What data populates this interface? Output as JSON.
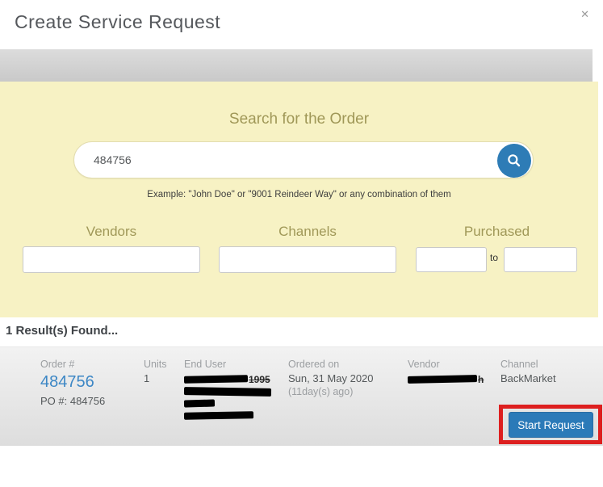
{
  "modal": {
    "title": "Create Service Request",
    "close_glyph": "✕"
  },
  "search": {
    "heading": "Search for the Order",
    "query": "484756",
    "hint": "Example: \"John Doe\" or \"9001 Reindeer Way\" or any combination of them",
    "filters": {
      "vendors_label": "Vendors",
      "channels_label": "Channels",
      "purchased_label": "Purchased",
      "to_label": "to"
    }
  },
  "results": {
    "count_text": "1 Result(s) Found...",
    "row": {
      "order_label": "Order #",
      "order_number": "484756",
      "po_text": "PO #: 484756",
      "units_label": "Units",
      "units_value": "1",
      "end_user_label": "End User",
      "end_user_redactions": [
        {
          "style": "width:79px",
          "peek": "1995"
        },
        {
          "style": "width:108px",
          "peek": ""
        },
        {
          "style": "width:38px",
          "peek": ""
        },
        {
          "style": "width:86px",
          "peek": ""
        }
      ],
      "ordered_label": "Ordered on",
      "ordered_date": "Sun, 31 May 2020",
      "ordered_ago": "(11day(s) ago)",
      "vendor_label": "Vendor",
      "vendor_redaction": {
        "style": "width:86px",
        "peek": "h"
      },
      "channel_label": "Channel",
      "channel_value": "BackMarket",
      "start_button_label": "Start Request"
    }
  },
  "colors": {
    "accent_blue": "#2e7cb6",
    "panel_yellow": "#f7f2c4",
    "olive_label": "#a09858",
    "annotation_red": "#dd1f1f",
    "link_blue": "#3d87c5"
  }
}
